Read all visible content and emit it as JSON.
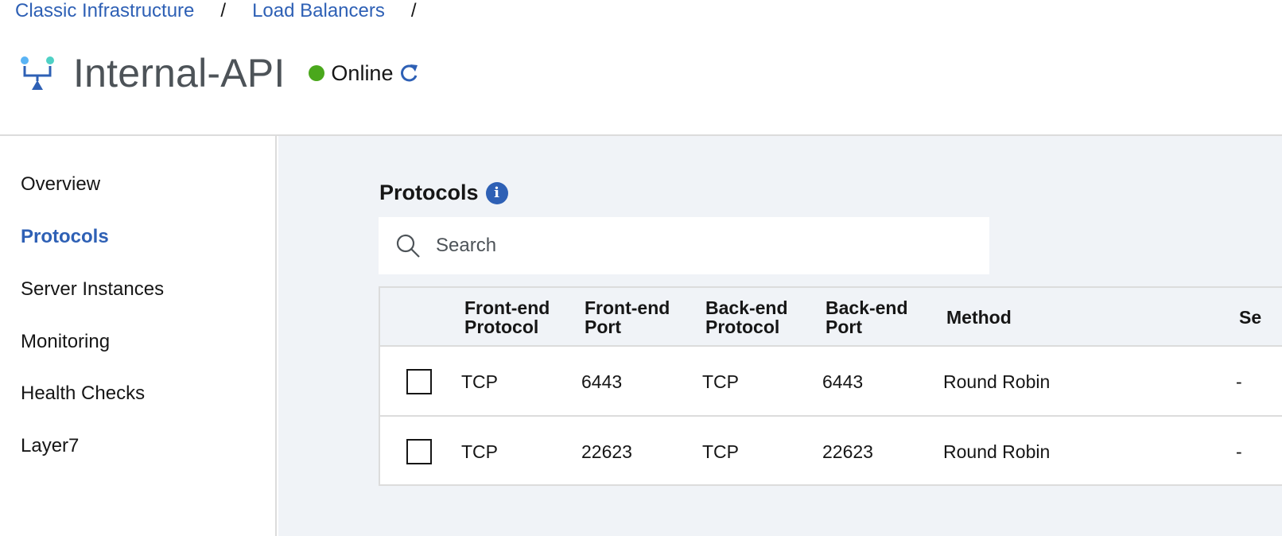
{
  "breadcrumb": {
    "items": [
      "Classic Infrastructure",
      "Load Balancers"
    ],
    "separator": "/"
  },
  "header": {
    "title": "Internal-API",
    "status": "Online",
    "status_color": "#4aa81c",
    "icon": "load-balancer-icon"
  },
  "sidebar": {
    "items": [
      {
        "label": "Overview",
        "active": false
      },
      {
        "label": "Protocols",
        "active": true
      },
      {
        "label": "Server Instances",
        "active": false
      },
      {
        "label": "Monitoring",
        "active": false
      },
      {
        "label": "Health Checks",
        "active": false
      },
      {
        "label": "Layer7",
        "active": false
      }
    ]
  },
  "main": {
    "section_title": "Protocols",
    "search": {
      "placeholder": "Search",
      "value": ""
    },
    "table": {
      "columns": [
        [
          "Front-end",
          "Protocol"
        ],
        [
          "Front-end",
          "Port"
        ],
        [
          "Back-end",
          "Protocol"
        ],
        [
          "Back-end",
          "Port"
        ],
        [
          "Method"
        ],
        [
          "Se"
        ]
      ],
      "rows": [
        [
          "TCP",
          "6443",
          "TCP",
          "6443",
          "Round Robin",
          "-"
        ],
        [
          "TCP",
          "22623",
          "TCP",
          "22623",
          "Round Robin",
          "-"
        ]
      ]
    }
  },
  "colors": {
    "accent": "#2e60b5",
    "background": "#f0f3f7",
    "border": "#dcdcdc"
  }
}
